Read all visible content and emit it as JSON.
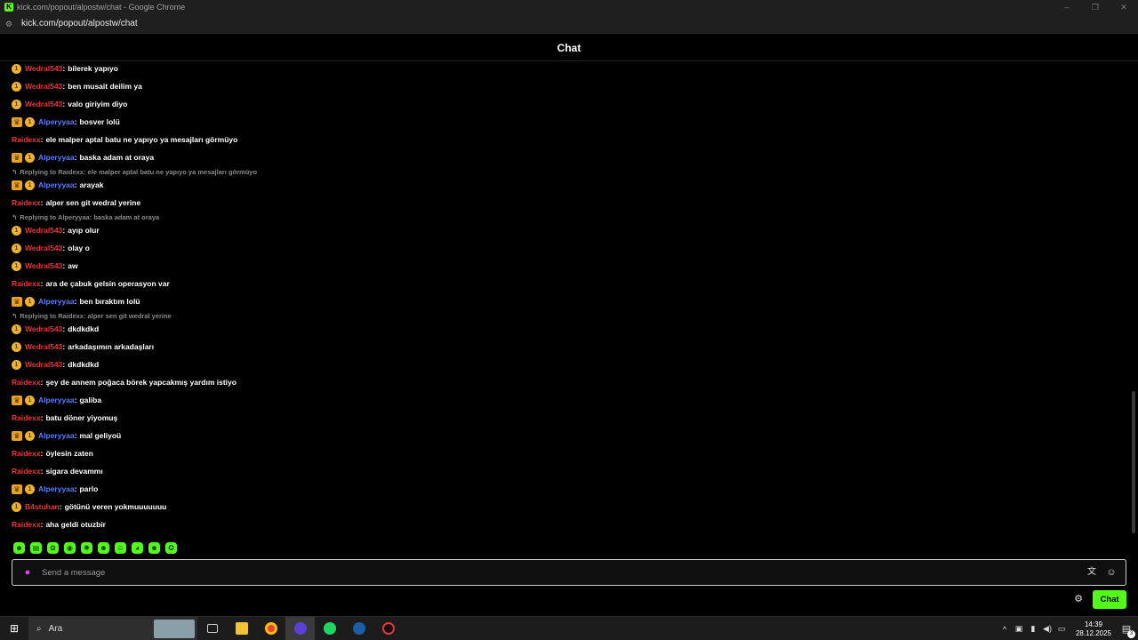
{
  "window": {
    "title": "kick.com/popout/alpostw/chat - Google Chrome",
    "favicon": "K",
    "controls": [
      "–",
      "❐",
      "✕"
    ]
  },
  "addressbar": {
    "url": "kick.com/popout/alpostw/chat"
  },
  "header": {
    "title": "Chat"
  },
  "colors": {
    "red_user": "#e8323c",
    "blue_user": "#5b7cff",
    "kick_green": "#53fc18",
    "reply_gray": "#8a8a8a"
  },
  "messages": [
    {
      "badges": [
        "sub"
      ],
      "user": "Wedral543",
      "color": "#e8323c",
      "text": "bilerek yapıyo"
    },
    {
      "badges": [
        "sub"
      ],
      "user": "Wedral543",
      "color": "#e8323c",
      "text": "ben musait deilim ya"
    },
    {
      "badges": [
        "sub"
      ],
      "user": "Wedral543",
      "color": "#e8323c",
      "text": "valo giriyim diyo"
    },
    {
      "badges": [
        "crown",
        "sub"
      ],
      "user": "Alperyyaa",
      "color": "#5b7cff",
      "text": "bosver lolü"
    },
    {
      "badges": [],
      "user": "Raidexx",
      "color": "#e8323c",
      "text": "ele malper aptal batu ne yapıyo ya mesajları görmüyo"
    },
    {
      "badges": [
        "crown",
        "sub"
      ],
      "user": "Alperyyaa",
      "color": "#5b7cff",
      "text": "baska adam at oraya"
    },
    {
      "reply": "Replying to Raidexx: ele malper aptal batu ne yapıyo ya mesajları görmüyo"
    },
    {
      "badges": [
        "crown",
        "sub"
      ],
      "user": "Alperyyaa",
      "color": "#5b7cff",
      "text": "arayak"
    },
    {
      "badges": [],
      "user": "Raidexx",
      "color": "#e8323c",
      "text": "alper sen git wedral yerine"
    },
    {
      "reply": "Replying to Alperyyaa: baska adam at oraya"
    },
    {
      "badges": [
        "sub"
      ],
      "user": "Wedral543",
      "color": "#e8323c",
      "text": "ayıp olur"
    },
    {
      "badges": [
        "sub"
      ],
      "user": "Wedral543",
      "color": "#e8323c",
      "text": "olay o"
    },
    {
      "badges": [
        "sub"
      ],
      "user": "Wedral543",
      "color": "#e8323c",
      "text": "aw"
    },
    {
      "badges": [],
      "user": "Raidexx",
      "color": "#e8323c",
      "text": "ara de çabuk gelsin operasyon var"
    },
    {
      "badges": [
        "crown",
        "sub"
      ],
      "user": "Alperyyaa",
      "color": "#5b7cff",
      "text": "ben bıraktım lolü"
    },
    {
      "reply": "Replying to Raidexx: alper sen git wedral yerine"
    },
    {
      "badges": [
        "sub"
      ],
      "user": "Wedral543",
      "color": "#e8323c",
      "text": "dkdkdkd"
    },
    {
      "badges": [
        "sub"
      ],
      "user": "Wedral543",
      "color": "#e8323c",
      "text": "arkadaşımın arkadaşları"
    },
    {
      "badges": [
        "sub"
      ],
      "user": "Wedral543",
      "color": "#e8323c",
      "text": "dkdkdkd"
    },
    {
      "badges": [],
      "user": "Raidexx",
      "color": "#e8323c",
      "text": "şey de annem poğaca börek yapcakmış yardım istiyo"
    },
    {
      "badges": [
        "crown",
        "sub"
      ],
      "user": "Alperyyaa",
      "color": "#5b7cff",
      "text": "galiba"
    },
    {
      "badges": [],
      "user": "Raidexx",
      "color": "#e8323c",
      "text": "batu döner yiyomuş"
    },
    {
      "badges": [
        "crown",
        "sub"
      ],
      "user": "Alperyyaa",
      "color": "#5b7cff",
      "text": "mal geliyoü"
    },
    {
      "badges": [],
      "user": "Raidexx",
      "color": "#e8323c",
      "text": "öylesin zaten"
    },
    {
      "badges": [],
      "user": "Raidexx",
      "color": "#e8323c",
      "text": "sigara devammı"
    },
    {
      "badges": [
        "crown",
        "sub"
      ],
      "user": "Alperyyaa",
      "color": "#5b7cff",
      "text": "parlo"
    },
    {
      "badges": [
        "sub"
      ],
      "user": "B4stuhan",
      "color": "#e8323c",
      "text": "götünü veren yokmuuuuuuu"
    },
    {
      "badges": [],
      "user": "Raidexx",
      "color": "#e8323c",
      "text": "aha geldi otuzbir"
    }
  ],
  "emotes": [
    "emote-1",
    "emote-2",
    "emote-3",
    "emote-4",
    "emote-5",
    "emote-6",
    "emote-7",
    "emote-8",
    "emote-9",
    "emote-10"
  ],
  "input": {
    "placeholder": "Send a message"
  },
  "chat_button": "Chat",
  "taskbar": {
    "search_label": "Ara",
    "apps": [
      "task-view-icon",
      "file-explorer-icon",
      "chrome-icon",
      "obs-icon",
      "spotify-icon",
      "steam-icon",
      "kick-icon"
    ],
    "time": "14:39",
    "date": "28.12.2025",
    "notification_count": "3"
  }
}
